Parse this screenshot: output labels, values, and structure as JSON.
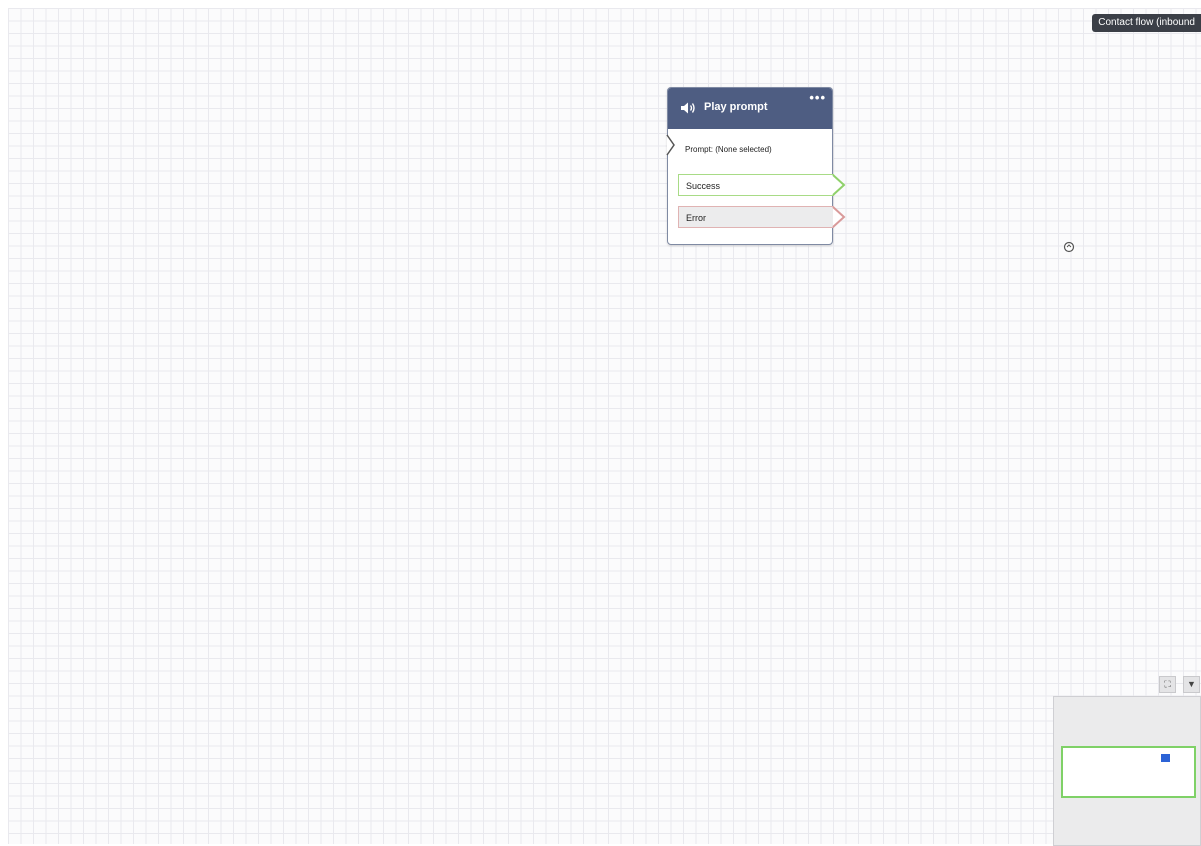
{
  "flow_tag": {
    "label": "Contact flow (inbound"
  },
  "block": {
    "title": "Play prompt",
    "menu": "•••",
    "prompt_text": "Prompt: (None selected)",
    "branches": {
      "success": "Success",
      "error": "Error"
    }
  },
  "minimap": {
    "fit_icon": "⛶",
    "collapse_icon": "▼"
  },
  "colors": {
    "header": "#4e5d82",
    "success": "#a8db86",
    "error": "#e0b3b3",
    "minimap_block": "#2c63d6"
  }
}
